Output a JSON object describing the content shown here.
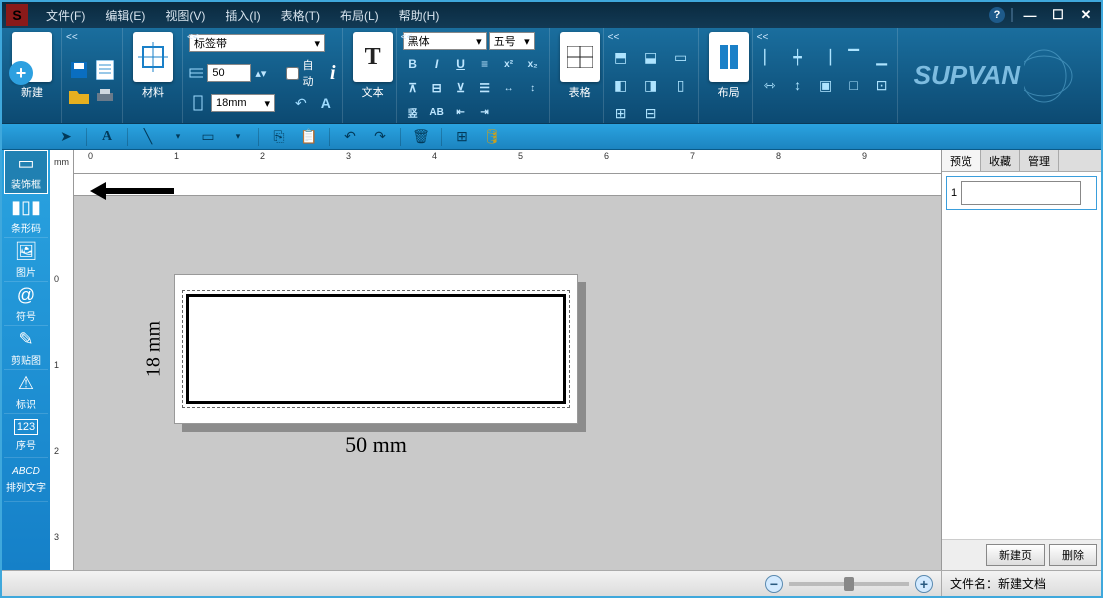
{
  "menu": {
    "file": "文件(F)",
    "edit": "编辑(E)",
    "view": "视图(V)",
    "insert": "插入(I)",
    "table": "表格(T)",
    "layout": "布局(L)",
    "help": "帮助(H)"
  },
  "ribbon": {
    "new": "新建",
    "material": "材料",
    "tape_type": "标签带",
    "width_val": "50",
    "auto": "自动",
    "height_sel": "18mm",
    "text": "文本",
    "font": "黑体",
    "fontsize": "五号",
    "table": "表格",
    "layout": "布局"
  },
  "brand": "SUPVAN",
  "lefttools": {
    "frame": "装饰框",
    "barcode": "条形码",
    "image": "图片",
    "symbol": "符号",
    "clipart": "剪贴图",
    "mark": "标识",
    "serial": "序号",
    "arrange": "排列文字"
  },
  "ruler_unit": "mm",
  "label": {
    "height": "18 mm",
    "width": "50 mm"
  },
  "rightpanel": {
    "preview": "预览",
    "collect": "收藏",
    "manage": "管理",
    "page_num": "1",
    "newpage": "新建页",
    "delete": "删除"
  },
  "status": {
    "filename_label": "文件名：",
    "filename": "新建文档"
  },
  "serial_label": "123",
  "arrange_label": "ABCD"
}
